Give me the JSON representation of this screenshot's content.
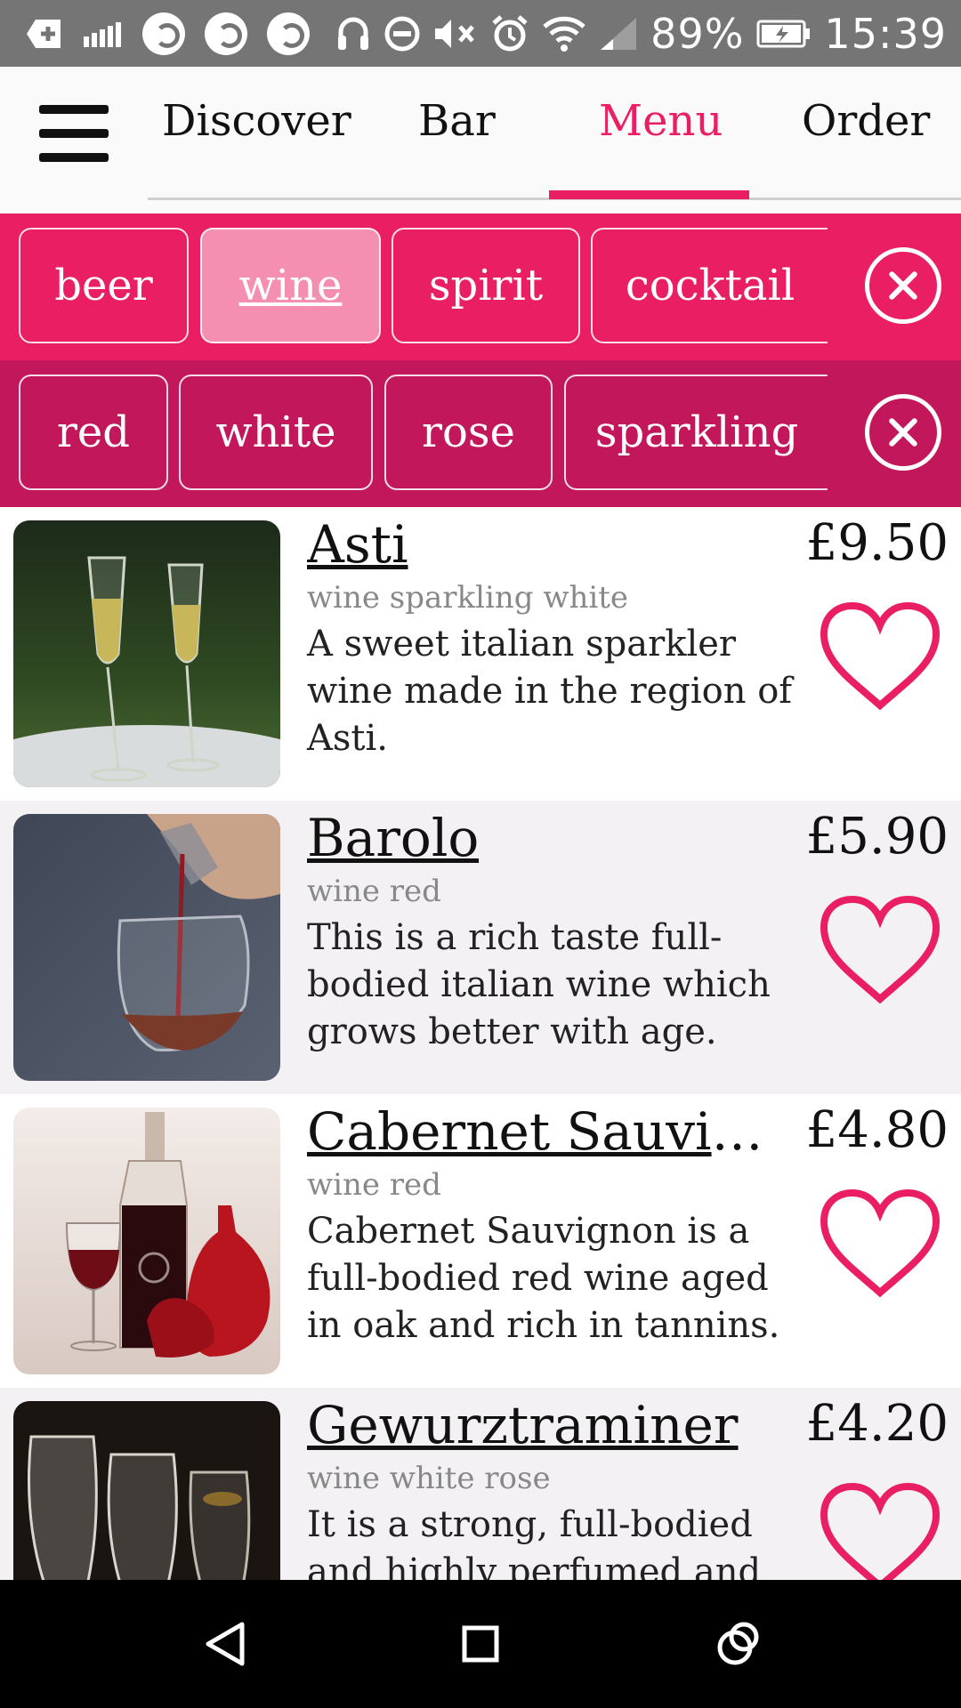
{
  "status_bar": {
    "battery_percent": "89%",
    "time": "15:39",
    "icons": [
      "add-icon",
      "signal-bars-icon",
      "app-icon",
      "app-icon",
      "app-icon",
      "headset-icon",
      "do-not-disturb-icon",
      "mute-icon",
      "alarm-icon",
      "wifi-icon",
      "cell-signal-icon",
      "battery-charging-icon"
    ]
  },
  "nav": {
    "tabs": [
      {
        "label": "Discover"
      },
      {
        "label": "Bar"
      },
      {
        "label": "Menu"
      },
      {
        "label": "Order"
      }
    ],
    "active_tab": "Menu",
    "accent_color": "#e91e63"
  },
  "filters": {
    "categories": [
      {
        "label": "beer"
      },
      {
        "label": "wine"
      },
      {
        "label": "spirit"
      },
      {
        "label": "cocktail"
      }
    ],
    "selected_category": "wine",
    "subcategories": [
      {
        "label": "red"
      },
      {
        "label": "white"
      },
      {
        "label": "rose"
      },
      {
        "label": "sparkling"
      }
    ]
  },
  "items": [
    {
      "name": "Asti",
      "price": "£9.50",
      "tags": "wine sparkling white",
      "description": "A sweet italian sparkler wine made in the region of Asti.",
      "favorite": false
    },
    {
      "name": "Barolo",
      "price": "£5.90",
      "tags": "wine red",
      "description": "This is a rich taste full-bodied italian wine which grows better with age.",
      "favorite": false
    },
    {
      "name": "Cabernet Sauvignon",
      "price": "£4.80",
      "tags": "wine red",
      "description": "Cabernet Sauvignon is a full-bodied red wine aged in oak and rich in tannins.",
      "favorite": false
    },
    {
      "name": "Gewurztraminer",
      "price": "£4.20",
      "tags": "wine white rose",
      "description": "It is a strong, full-bodied and highly perfumed and",
      "favorite": false
    }
  ]
}
